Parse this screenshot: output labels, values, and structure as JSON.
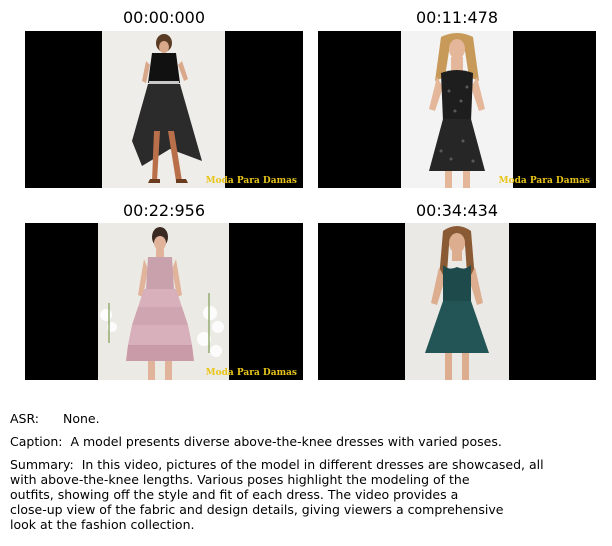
{
  "frames": [
    {
      "timestamp": "00:00:000",
      "watermark": "Moda Para Damas",
      "dress": "black lace high-low dress with belt"
    },
    {
      "timestamp": "00:11:478",
      "watermark": "Moda Para Damas",
      "dress": "black sequin strapless short dress"
    },
    {
      "timestamp": "00:22:956",
      "watermark": "Moda Para Damas",
      "dress": "pink ruffled tiered dress"
    },
    {
      "timestamp": "00:34:434",
      "watermark": "",
      "dress": "teal sweetheart skater dress"
    }
  ],
  "watermark_color": "#e8c51a",
  "asr": {
    "label": "ASR:",
    "value": "None."
  },
  "caption": {
    "label": "Caption:",
    "value": "A model presents diverse above-the-knee dresses with varied poses."
  },
  "summary": {
    "label": "Summary:",
    "lines": [
      "In this video, pictures of the model in different dresses are showcased, all",
      "with above-the-knee lengths. Various poses highlight the modeling of the",
      "outfits, showing off the style and fit of each dress. The video provides a",
      "close-up view of the fabric and design details, giving viewers a comprehensive",
      "look at the fashion collection."
    ]
  }
}
